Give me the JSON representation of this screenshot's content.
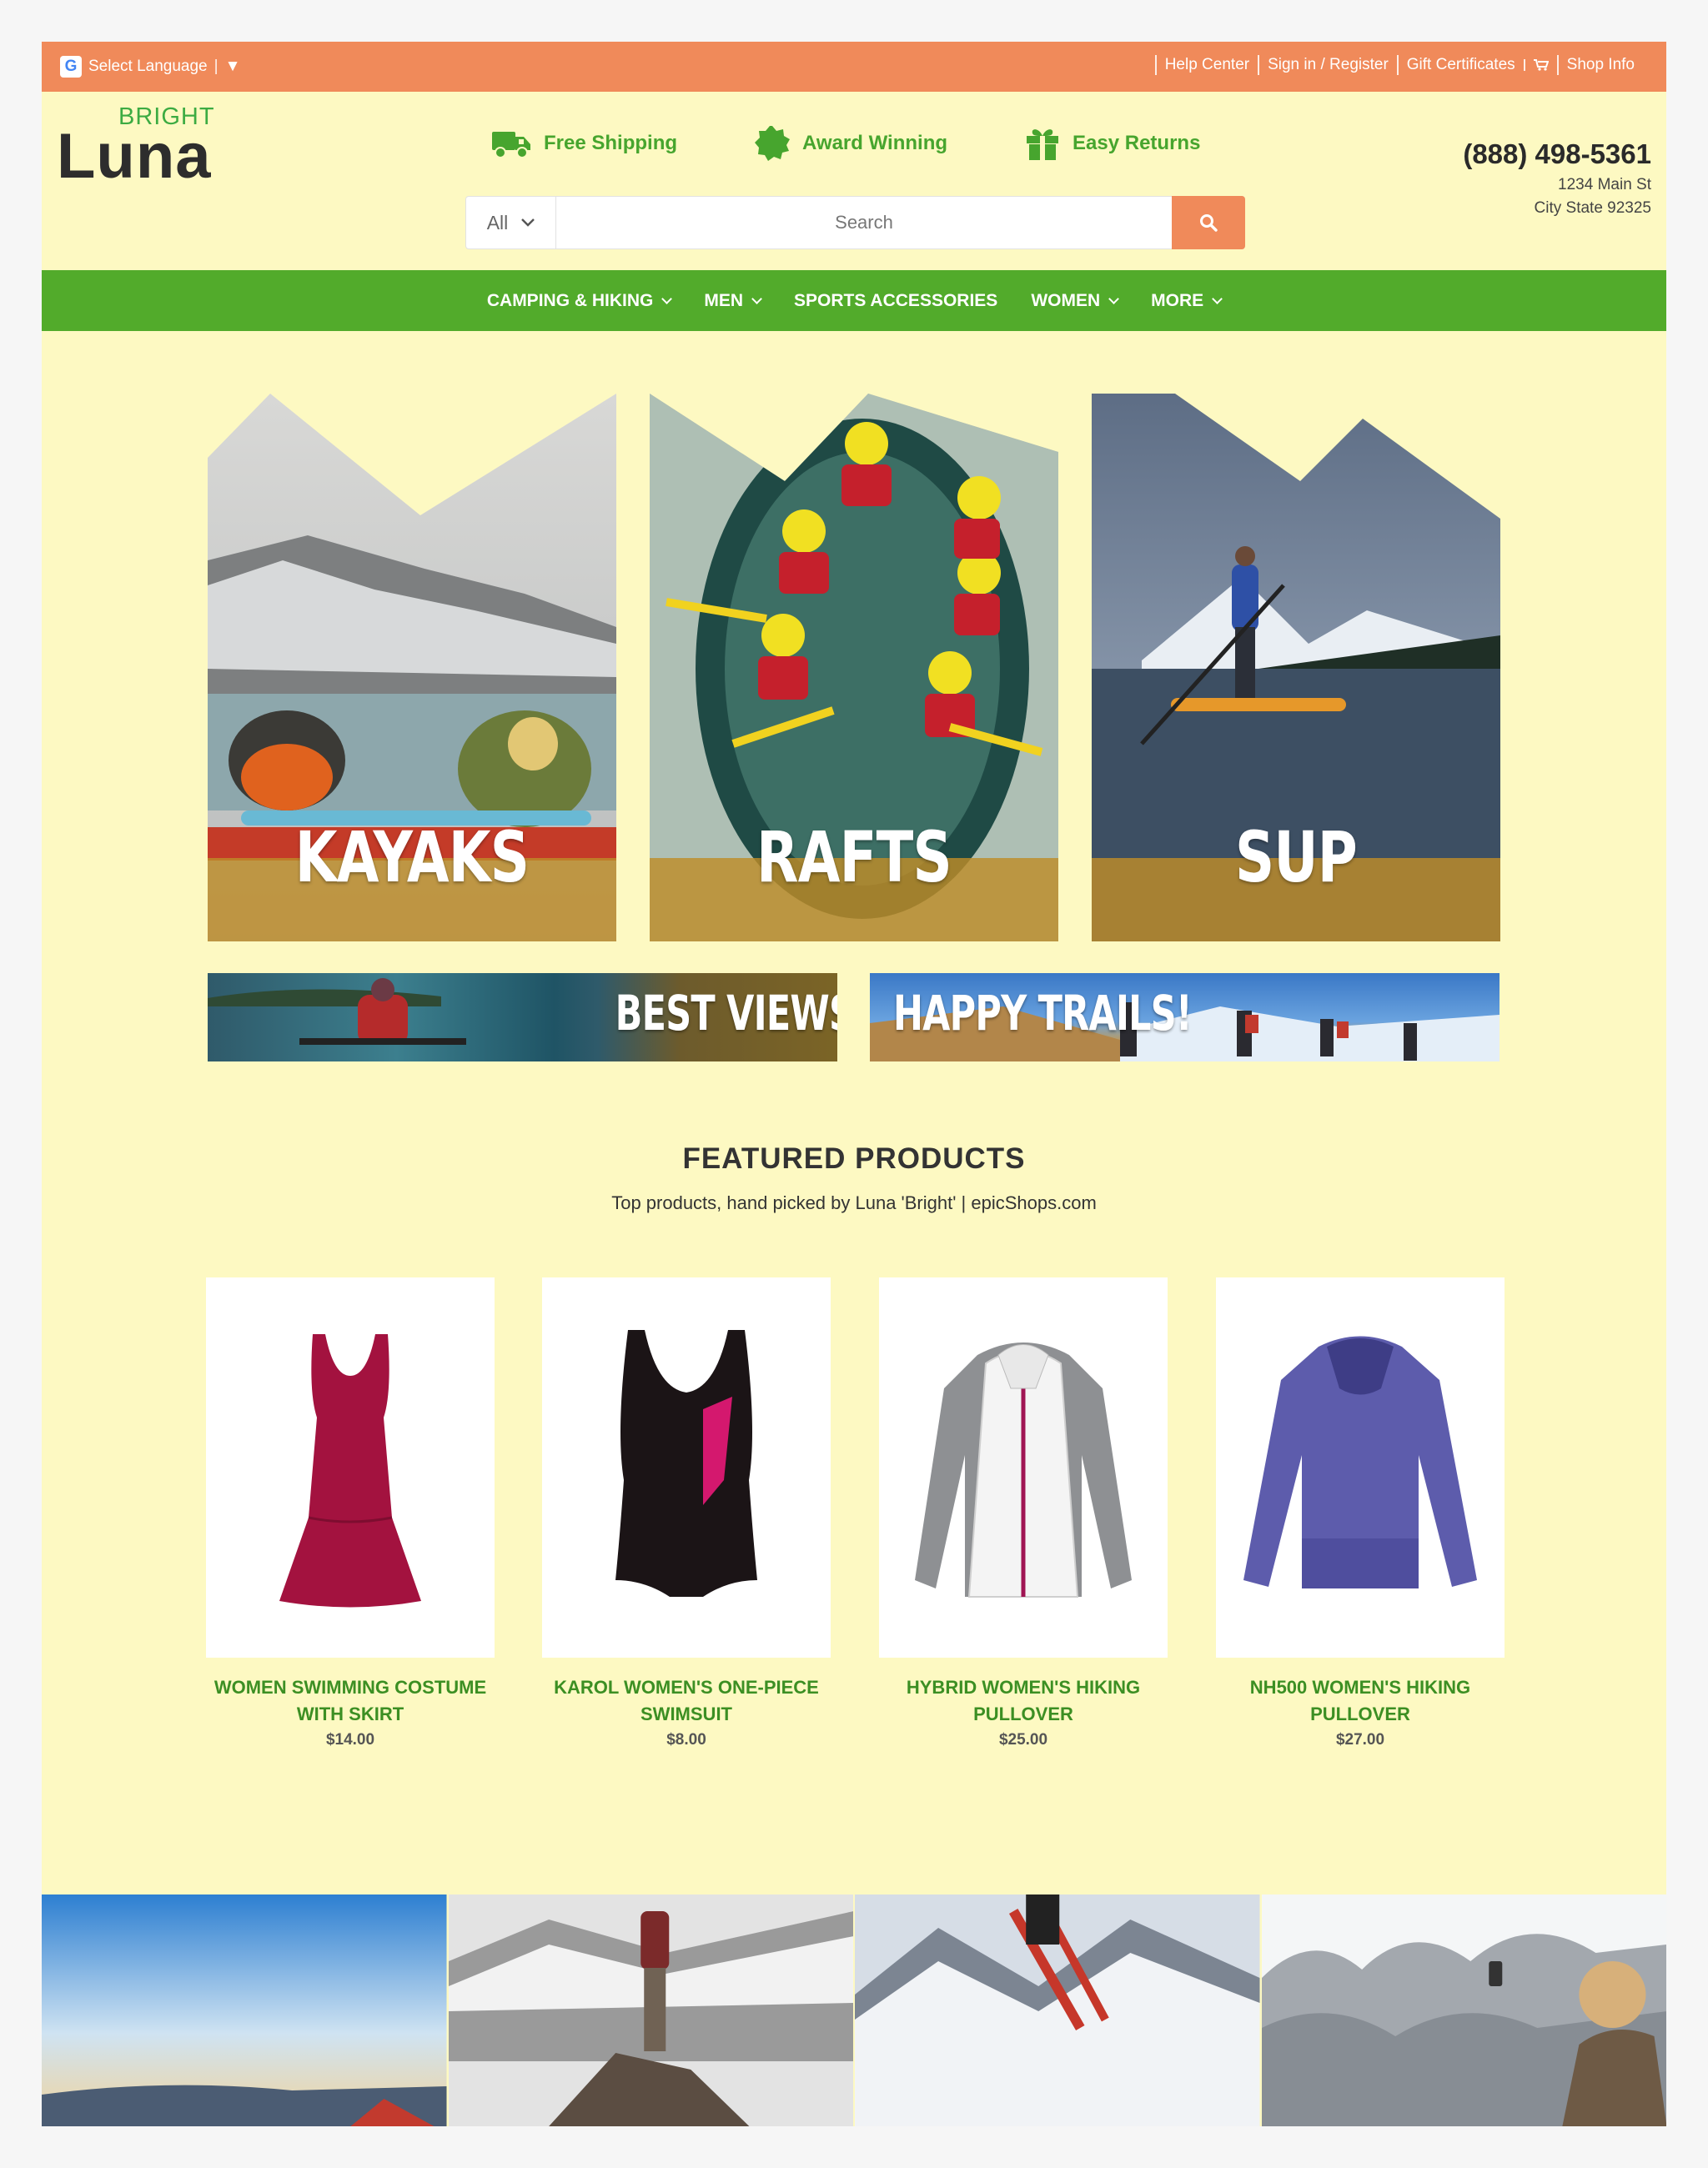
{
  "topbar": {
    "language_label": "Select Language",
    "language_arrow": "▼",
    "links": [
      "Help Center",
      "Sign in / Register",
      "Gift Certificates",
      "Shop Info"
    ]
  },
  "brand": {
    "bright": "BRIGHT",
    "luna": "Luna"
  },
  "perks": [
    {
      "label": "Free Shipping",
      "icon": "truck-icon"
    },
    {
      "label": "Award Winning",
      "icon": "award-badge-icon"
    },
    {
      "label": "Easy Returns",
      "icon": "gift-icon"
    }
  ],
  "search": {
    "category": "All",
    "placeholder": "Search"
  },
  "contact": {
    "phone": "(888) 498-5361",
    "address_line1": "1234 Main St",
    "address_line2": "City State 92325"
  },
  "nav": [
    {
      "label": "CAMPING & HIKING",
      "dropdown": true
    },
    {
      "label": "MEN",
      "dropdown": true
    },
    {
      "label": "SPORTS ACCESSORIES",
      "dropdown": false
    },
    {
      "label": "WOMEN",
      "dropdown": true
    },
    {
      "label": "MORE",
      "dropdown": true
    }
  ],
  "categories": [
    "KAYAKS",
    "RAFTS",
    "SUP"
  ],
  "banners": [
    "BEST VIEWS",
    "HAPPY TRAILS!"
  ],
  "featured": {
    "title": "FEATURED PRODUCTS",
    "subtitle": "Top products, hand picked by Luna 'Bright' | epicShops.com",
    "products": [
      {
        "name": "WOMEN SWIMMING COSTUME WITH SKIRT",
        "price": "$14.00"
      },
      {
        "name": "KAROL WOMEN'S ONE-PIECE SWIMSUIT",
        "price": "$8.00"
      },
      {
        "name": "HYBRID WOMEN'S HIKING PULLOVER",
        "price": "$25.00"
      },
      {
        "name": "NH500 WOMEN'S HIKING PULLOVER",
        "price": "$27.00"
      }
    ]
  },
  "colors": {
    "topbar": "#f08a5a",
    "nav": "#52ab2b",
    "page": "#fdf9c2",
    "accent_green": "#47a52e"
  }
}
